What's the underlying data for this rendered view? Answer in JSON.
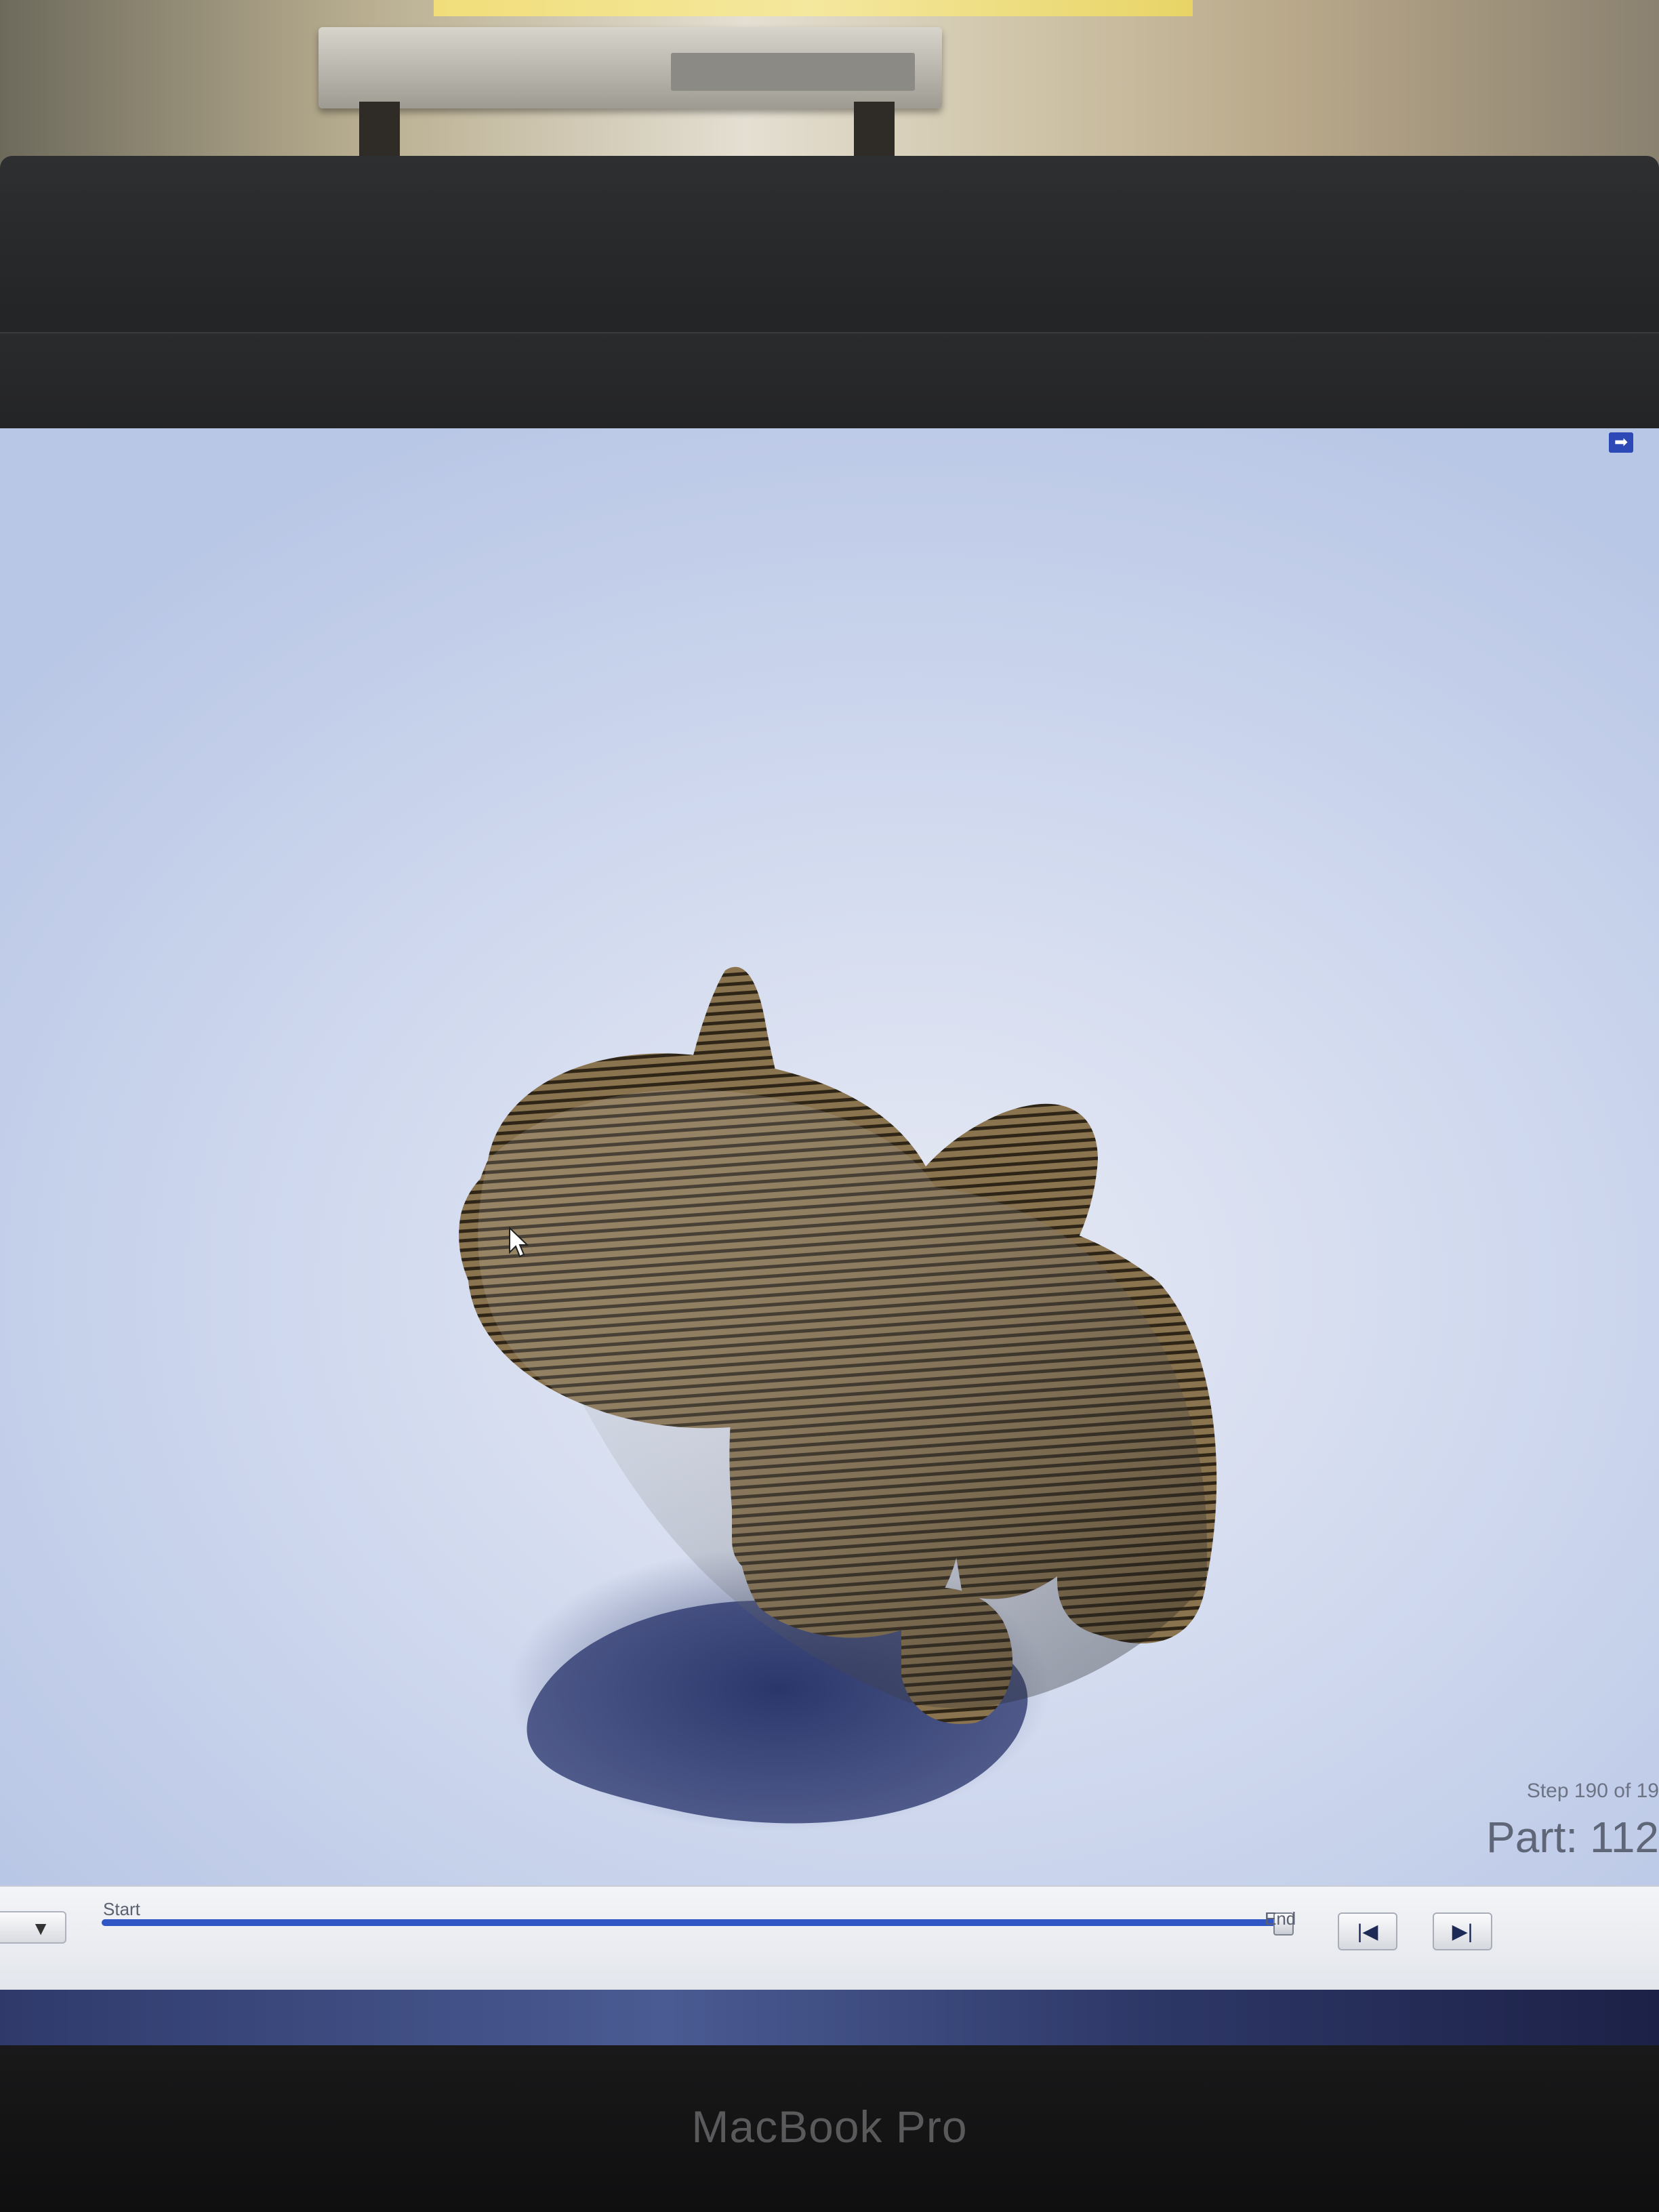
{
  "viewer": {
    "corner_icon": "arrow-right-icon",
    "step_text": "Step 190 of 19",
    "part_text": "Part: 112"
  },
  "controls": {
    "dropdown_glyph": "▼",
    "start_label": "Start",
    "end_label": "End",
    "progress": 0.99,
    "first_button_glyph": "|◀",
    "last_button_glyph": "▶|"
  },
  "device": {
    "brand": "MacBook Pro"
  },
  "colors": {
    "model": "#8a7450",
    "model_dark": "#3a2e1d",
    "slider_fill": "#2f56c4",
    "background": "#d3dbef"
  }
}
